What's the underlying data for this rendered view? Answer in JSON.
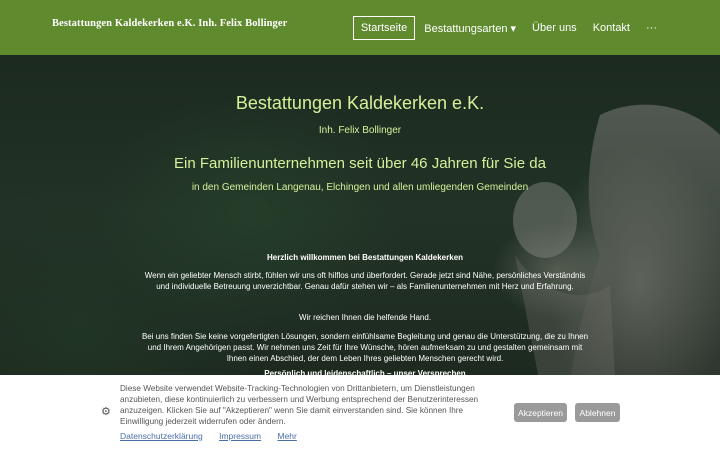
{
  "header": {
    "brand": "Bestattungen Kaldekerken e.K. Inh. Felix Bollinger",
    "nav": [
      {
        "label": "Startseite"
      },
      {
        "label": "Bestattungsarten ▾"
      },
      {
        "label": "Über uns"
      },
      {
        "label": "Kontakt"
      },
      {
        "label": "···"
      }
    ]
  },
  "hero": {
    "title": "Bestattungen Kaldekerken e.K.",
    "subtitle": "Inh. Felix Bollinger",
    "tagline": "Ein Familienunternehmen seit über 46 Jahren für Sie da",
    "region": "in den Gemeinden Langenau, Elchingen und allen umliegenden Gemeinden"
  },
  "content": {
    "welcome": "Herzlich willkommen bei Bestattungen Kaldekerken",
    "p1": "Wenn ein geliebter Mensch stirbt, fühlen wir uns oft hilflos und überfordert. Gerade jetzt sind Nähe, persönliches Verständnis und individuelle Betreuung unverzichtbar. Genau dafür stehen wir – als Familienunternehmen mit Herz und Erfahrung.",
    "p2": "Wir reichen Ihnen die helfende Hand.",
    "p3": "Bei uns finden Sie keine vorgefertigten Lösungen, sondern einfühlsame Begleitung und genau die Unterstützung, die zu Ihnen und Ihrem Angehörigen passt. Wir nehmen uns Zeit für Ihre Wünsche, hören aufmerksam zu und gestalten gemeinsam mit Ihnen einen Abschied, der dem Leben Ihres geliebten Menschen gerecht wird.",
    "p4": "Persönlich und leidenschaftlich – unser Versprechen"
  },
  "cookie": {
    "text": "Diese Website verwendet Website-Tracking-Technologien von Drittanbietern, um Dienstleistungen anzubieten, diese kontinuierlich zu verbessern und Werbung entsprechend der Benutzerinteressen anzuzeigen. Klicken Sie auf \"Akzeptieren\" wenn Sie damit einverstanden sind. Sie können Ihre Einwilligung jederzeit widerrufen oder ändern.",
    "links": {
      "privacy": "Datenschutzerklärung",
      "imprint": "Impressum",
      "more": "Mehr"
    },
    "accept": "Akzeptieren",
    "decline": "Ablehnen",
    "icon": "cookie-icon"
  },
  "colors": {
    "header": "#5f8a2e",
    "accent_text": "#d7f09a",
    "button": "#9a9a9a",
    "link": "#4a6fa5"
  }
}
